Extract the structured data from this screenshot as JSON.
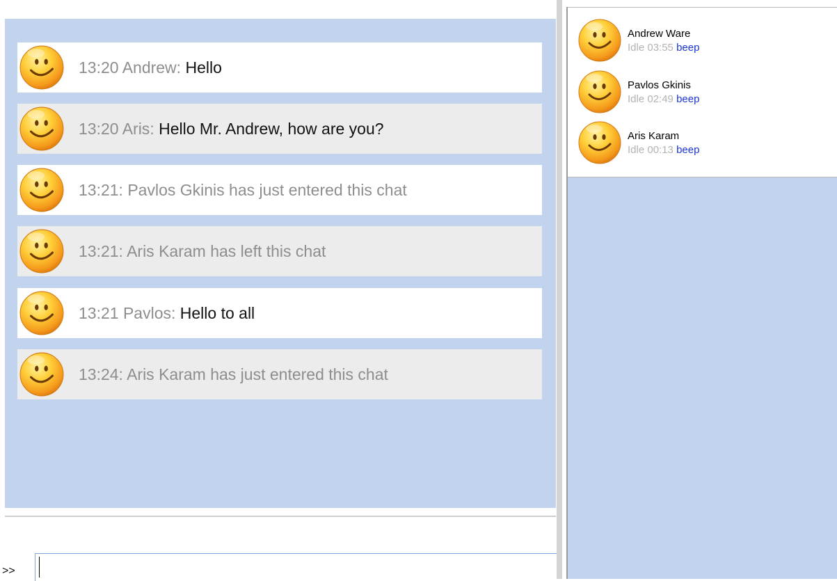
{
  "chat": {
    "messages": [
      {
        "time": "13:20",
        "sender": "Andrew",
        "text": "Hello",
        "kind": "message"
      },
      {
        "time": "13:20",
        "sender": "Aris",
        "text": "Hello Mr. Andrew, how are you?",
        "kind": "message"
      },
      {
        "time": "13:21",
        "text": "13:21: Pavlos Gkinis has just entered this chat",
        "kind": "system"
      },
      {
        "time": "13:21",
        "text": "13:21: Aris Karam has left this chat",
        "kind": "system"
      },
      {
        "time": "13:21",
        "sender": "Pavlos",
        "text": "Hello to all",
        "kind": "message"
      },
      {
        "time": "13:24",
        "text": "13:24: Aris Karam has just entered this chat",
        "kind": "system"
      }
    ],
    "avatar_icon": "smiley-face-icon"
  },
  "input": {
    "prompt": ">>",
    "value": "",
    "placeholder": ""
  },
  "users": [
    {
      "name": "Andrew Ware",
      "idle": "Idle 03:55",
      "action": "beep"
    },
    {
      "name": "Pavlos Gkinis",
      "idle": "Idle 02:49",
      "action": "beep"
    },
    {
      "name": "Aris Karam",
      "idle": "Idle 00:13",
      "action": "beep"
    }
  ],
  "colors": {
    "pane_background": "#c2d3ee",
    "beep_link": "#1b35d6",
    "meta_text": "#8d8d8d"
  }
}
